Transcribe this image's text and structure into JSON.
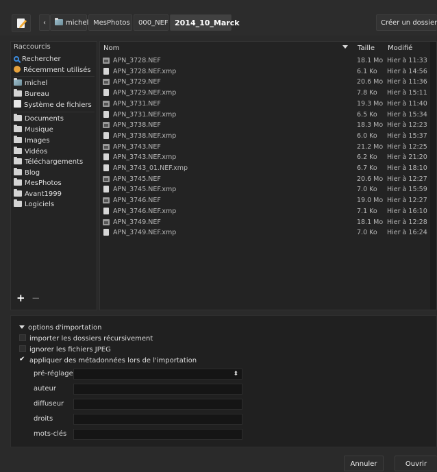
{
  "path_bar": {
    "segments": [
      "michel",
      "MesPhotos",
      "000_NEF",
      "2014_10_Marck"
    ],
    "create_folder_label": "Créer un dossier"
  },
  "sidebar": {
    "header": "Raccourcis",
    "items": [
      {
        "label": "Rechercher",
        "icon": "search-icon"
      },
      {
        "label": "Récemment utilisés",
        "icon": "clock-icon"
      },
      {
        "label": "michel",
        "icon": "home-folder-icon"
      },
      {
        "label": "Bureau",
        "icon": "folder-icon"
      },
      {
        "label": "Système de fichiers",
        "icon": "drive-icon"
      },
      {
        "label": "Documents",
        "icon": "folder-icon"
      },
      {
        "label": "Musique",
        "icon": "folder-icon"
      },
      {
        "label": "Images",
        "icon": "folder-icon"
      },
      {
        "label": "Vidéos",
        "icon": "folder-icon"
      },
      {
        "label": "Téléchargements",
        "icon": "folder-icon"
      },
      {
        "label": "Blog",
        "icon": "folder-icon"
      },
      {
        "label": "MesPhotos",
        "icon": "folder-icon"
      },
      {
        "label": "Avant1999",
        "icon": "folder-icon"
      },
      {
        "label": "Logiciels",
        "icon": "folder-icon"
      }
    ],
    "add_label": "+",
    "remove_label": "−"
  },
  "file_list": {
    "columns": {
      "name": "Nom",
      "size": "Taille",
      "modified": "Modifié"
    },
    "rows": [
      {
        "name": "APN_3728.NEF",
        "size": "18.1 Mo",
        "modified": "Hier à 11:33",
        "type": "image"
      },
      {
        "name": "APN_3728.NEF.xmp",
        "size": "6.1 Ko",
        "modified": "Hier à 14:56",
        "type": "doc"
      },
      {
        "name": "APN_3729.NEF",
        "size": "20.6 Mo",
        "modified": "Hier à 11:36",
        "type": "image"
      },
      {
        "name": "APN_3729.NEF.xmp",
        "size": "7.8 Ko",
        "modified": "Hier à 15:11",
        "type": "doc"
      },
      {
        "name": "APN_3731.NEF",
        "size": "19.3 Mo",
        "modified": "Hier à 11:40",
        "type": "image"
      },
      {
        "name": "APN_3731.NEF.xmp",
        "size": "6.5 Ko",
        "modified": "Hier à 15:34",
        "type": "doc"
      },
      {
        "name": "APN_3738.NEF",
        "size": "18.3 Mo",
        "modified": "Hier à 12:23",
        "type": "image"
      },
      {
        "name": "APN_3738.NEF.xmp",
        "size": "6.0 Ko",
        "modified": "Hier à 15:37",
        "type": "doc"
      },
      {
        "name": "APN_3743.NEF",
        "size": "21.2 Mo",
        "modified": "Hier à 12:25",
        "type": "image"
      },
      {
        "name": "APN_3743.NEF.xmp",
        "size": "6.2 Ko",
        "modified": "Hier à 21:20",
        "type": "doc"
      },
      {
        "name": "APN_3743_01.NEF.xmp",
        "size": "6.7 Ko",
        "modified": "Hier à 18:10",
        "type": "doc"
      },
      {
        "name": "APN_3745.NEF",
        "size": "20.6 Mo",
        "modified": "Hier à 12:27",
        "type": "image"
      },
      {
        "name": "APN_3745.NEF.xmp",
        "size": "7.0 Ko",
        "modified": "Hier à 15:59",
        "type": "doc"
      },
      {
        "name": "APN_3746.NEF",
        "size": "19.0 Mo",
        "modified": "Hier à 12:27",
        "type": "image"
      },
      {
        "name": "APN_3746.NEF.xmp",
        "size": "7.1 Ko",
        "modified": "Hier à 16:10",
        "type": "doc"
      },
      {
        "name": "APN_3749.NEF",
        "size": "18.1 Mo",
        "modified": "Hier à 12:28",
        "type": "image"
      },
      {
        "name": "APN_3749.NEF.xmp",
        "size": "7.0 Ko",
        "modified": "Hier à 16:24",
        "type": "doc"
      }
    ]
  },
  "import_options": {
    "header": "options d'importation",
    "recursive_label": "importer les dossiers récursivement",
    "ignore_jpeg_label": "ignorer les fichiers JPEG",
    "apply_metadata_label": "appliquer des métadonnées lors de l'importation",
    "recursive_checked": false,
    "ignore_jpeg_checked": false,
    "apply_metadata_checked": true,
    "fields": {
      "preset_label": "pré-réglage",
      "preset_value": "",
      "author_label": "auteur",
      "author_value": "",
      "publisher_label": "diffuseur",
      "publisher_value": "",
      "rights_label": "droits",
      "rights_value": "",
      "tags_label": "mots-clés",
      "tags_value": ""
    }
  },
  "footer": {
    "cancel_label": "Annuler",
    "open_label": "Ouvrir"
  }
}
